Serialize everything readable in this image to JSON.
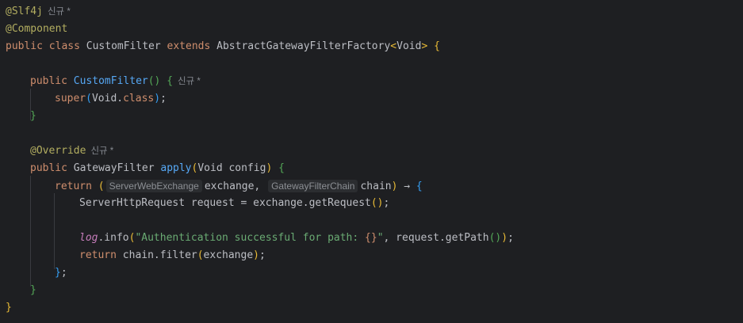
{
  "editor": {
    "lines": {
      "l1": {
        "annotation": "@Slf4j",
        "hint": "신규 *"
      },
      "l2": {
        "annotation": "@Component"
      },
      "l3": {
        "kw_public": "public",
        "kw_class": "class",
        "class_name": "CustomFilter",
        "kw_extends": "extends",
        "parent_class": "AbstractGatewayFilterFactory",
        "generic_open": "<",
        "generic_type": "Void",
        "generic_close": ">",
        "brace_open": "{"
      },
      "l5": {
        "kw_public": "public",
        "ctor_name": "CustomFilter",
        "paren_open": "(",
        "paren_close": ")",
        "brace_open": "{",
        "hint": "신규 *"
      },
      "l6": {
        "kw_super": "super",
        "paren_open": "(",
        "arg_type": "Void",
        "dot": ".",
        "kw_class": "class",
        "paren_close": ")",
        "semicolon": ";"
      },
      "l7": {
        "brace_close": "}"
      },
      "l9": {
        "annotation": "@Override",
        "hint": "신규 *"
      },
      "l10": {
        "kw_public": "public",
        "return_type": "GatewayFilter",
        "method_name": "apply",
        "paren_open": "(",
        "param": "Void config",
        "paren_close": ")",
        "brace_open": "{"
      },
      "l11": {
        "kw_return": "return",
        "paren_open": "(",
        "hint_type1": "ServerWebExchange",
        "param1": "exchange,",
        "hint_type2": "GatewayFilterChain",
        "param2": "chain",
        "paren_close": ")",
        "arrow": "→",
        "brace_open": "{"
      },
      "l12": {
        "decl": "ServerHttpRequest request = exchange.getRequest",
        "paren_pair": "()",
        "semicolon": ";"
      },
      "l14": {
        "log_field": "log",
        "log_call": ".info",
        "paren_open": "(",
        "string_literal": "\"Authentication successful for path: ",
        "placeholder": "{}",
        "string_end": "\"",
        "rest": ", request.getPath",
        "paren_pair": "()",
        "paren_close": ")",
        "semicolon": ";"
      },
      "l15": {
        "kw_return": "return",
        "call": "chain.filter",
        "paren_open": "(",
        "arg": "exchange",
        "paren_close": ")",
        "semicolon": ";"
      },
      "l16": {
        "brace_close": "}",
        "semicolon": ";"
      },
      "l17": {
        "brace_close": "}"
      },
      "l18": {
        "brace_close": "}"
      }
    }
  },
  "theme": {
    "background": "#1e1f22",
    "keyword": "#cf8e6d",
    "annotation": "#b3ae60",
    "function": "#56a8f5",
    "string": "#6aab73",
    "field": "#c77dbb",
    "text": "#bcbec4"
  }
}
